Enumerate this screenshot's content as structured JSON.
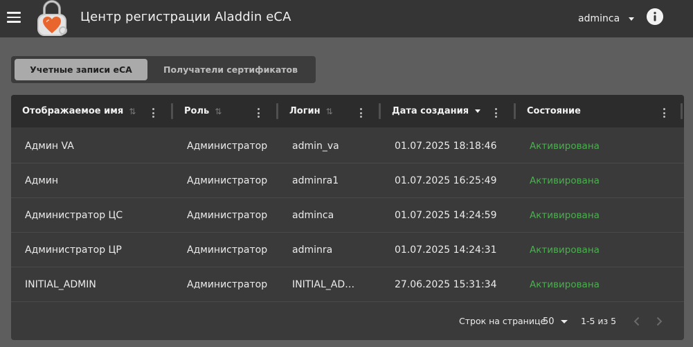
{
  "app": {
    "title": "Центр регистрации Aladdin eCA",
    "user": "adminca"
  },
  "icons": {
    "menu": "hamburger-menu-icon",
    "logo": "aladdin-lock-logo",
    "user_dropdown": "caret-down-icon",
    "info": "info-circle-icon",
    "sort": "sort-arrows-icon",
    "column_menu": "kebab-vertical-icon",
    "prev": "chevron-left-icon",
    "next": "chevron-right-icon"
  },
  "colors": {
    "topbar": "#353535",
    "background": "#5e5e5e",
    "table": "#3a3a3a",
    "table_header": "#2c2c2c",
    "active_tab": "#aaaaaa",
    "status_active": "#4caf50",
    "logo_orange": "#e8662e"
  },
  "tabs": [
    {
      "label": "Учетные записи eCA",
      "active": true
    },
    {
      "label": "Получатели сертификатов",
      "active": false
    }
  ],
  "table": {
    "columns": [
      {
        "label": "Отображаемое имя",
        "sort": "none"
      },
      {
        "label": "Роль",
        "sort": "none"
      },
      {
        "label": "Логин",
        "sort": "none"
      },
      {
        "label": "Дата создания",
        "sort": "desc"
      },
      {
        "label": "Состояние",
        "sort": "none"
      }
    ],
    "rows": [
      {
        "name": "Админ VA",
        "role": "Администратор",
        "login": "admin_va",
        "created": "01.07.2025 18:18:46",
        "status": "Активирована"
      },
      {
        "name": "Админ",
        "role": "Администратор",
        "login": "adminra1",
        "created": "01.07.2025 16:25:49",
        "status": "Активирована"
      },
      {
        "name": "Администратор ЦС",
        "role": "Администратор",
        "login": "adminca",
        "created": "01.07.2025 14:24:59",
        "status": "Активирована"
      },
      {
        "name": "Администратор ЦР",
        "role": "Администратор",
        "login": "adminra",
        "created": "01.07.2025 14:24:31",
        "status": "Активирована"
      },
      {
        "name": "INITIAL_ADMIN",
        "role": "Администратор",
        "login": "INITIAL_AD…",
        "created": "27.06.2025 15:31:34",
        "status": "Активирована"
      }
    ]
  },
  "pagination": {
    "rows_per_page_label": "Строк на странице",
    "rows_per_page": "50",
    "range": "1-5 из 5"
  }
}
